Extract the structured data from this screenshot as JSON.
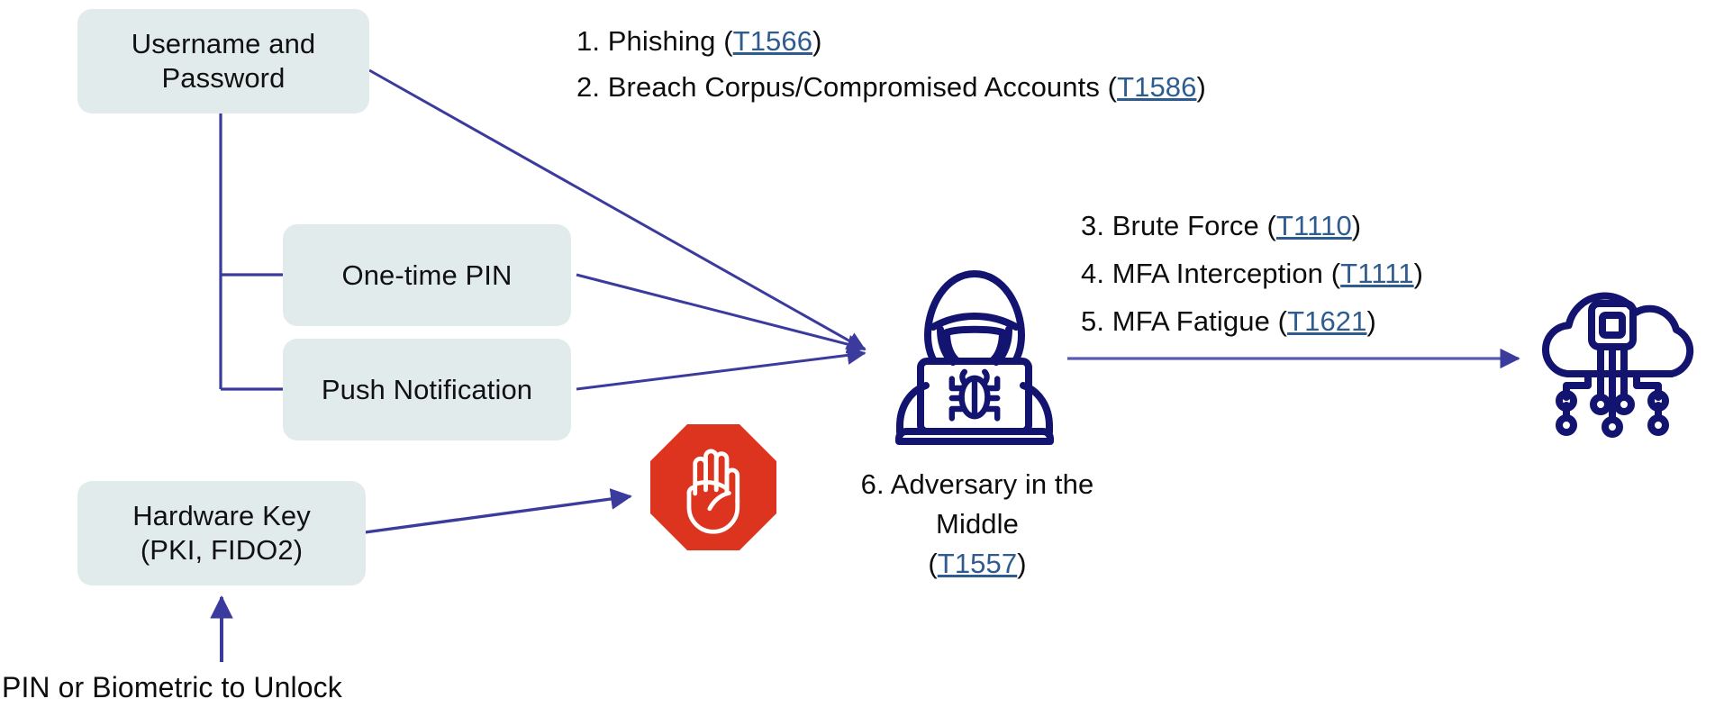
{
  "diagram": {
    "title": "MFA methods and adversary attack techniques",
    "colors": {
      "box_fill": "#e2ebec",
      "connector": "#3b3b9e",
      "icon_navy": "#131370",
      "stop_red": "#dd3420",
      "link_blue": "#2f5c8f",
      "text": "#0d0d0d"
    },
    "nodes": [
      {
        "id": "username-password",
        "lines": [
          "Username and",
          "Password"
        ]
      },
      {
        "id": "one-time-pin",
        "lines": [
          "One-time PIN"
        ]
      },
      {
        "id": "push-notification",
        "lines": [
          "Push Notification"
        ]
      },
      {
        "id": "hardware-key",
        "lines": [
          "Hardware Key",
          "(PKI, FIDO2)"
        ]
      }
    ],
    "unlock_label": "PIN or Biometric to Unlock",
    "techniques_top": [
      {
        "num": "1.",
        "name": "Phishing",
        "open": "(",
        "id": "T1566",
        "close": ")"
      },
      {
        "num": "2.",
        "name": "Breach Corpus/Compromised Accounts",
        "open": "(",
        "id": "T1586",
        "close": ")"
      }
    ],
    "techniques_middle": [
      {
        "num": "3.",
        "name": "Brute Force",
        "open": "(",
        "id": "T1110",
        "close": ")"
      },
      {
        "num": "4.",
        "name": "MFA Interception",
        "open": "(",
        "id": "T1111",
        "close": ")"
      },
      {
        "num": "5.",
        "name": "MFA Fatigue",
        "open": "(",
        "id": "T1621",
        "close": ")"
      }
    ],
    "technique_adversary": {
      "line1": "6. Adversary in the",
      "line2": "Middle",
      "open": "(",
      "id": "T1557",
      "close": ")"
    },
    "icons": [
      {
        "id": "stop-hand-icon",
        "label": "Stop hand octagon"
      },
      {
        "id": "hacker-laptop-icon",
        "label": "Hooded hacker at laptop with bug"
      },
      {
        "id": "cloud-computing-icon",
        "label": "Cloud with circuit chip"
      }
    ]
  }
}
